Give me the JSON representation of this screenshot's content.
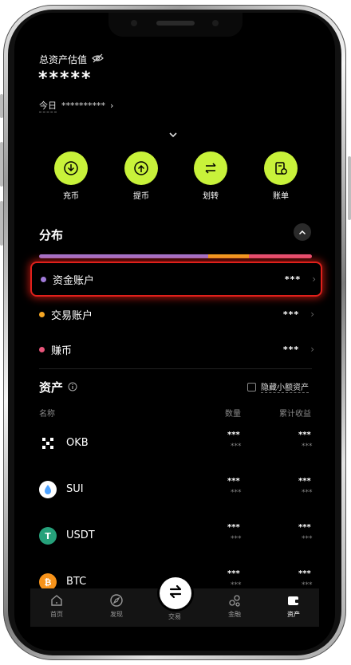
{
  "header": {
    "total_label": "总资产估值",
    "total_value": "*****",
    "today_label": "今日",
    "today_value": "**********"
  },
  "actions": [
    {
      "label": "充币",
      "icon": "deposit-icon"
    },
    {
      "label": "提币",
      "icon": "withdraw-icon"
    },
    {
      "label": "划转",
      "icon": "transfer-icon"
    },
    {
      "label": "账单",
      "icon": "bill-icon"
    }
  ],
  "distribution": {
    "title": "分布",
    "bar_shares": [
      0.62,
      0.15,
      0.23
    ],
    "bar_colors": [
      "#a07ad8",
      "#f5a623",
      "#e8557a"
    ],
    "rows": [
      {
        "name": "资金账户",
        "value": "***",
        "dot": "#a07ad8"
      },
      {
        "name": "交易账户",
        "value": "***",
        "dot": "#f5a623"
      },
      {
        "name": "赚币",
        "value": "***",
        "dot": "#e8557a"
      }
    ]
  },
  "assets": {
    "title": "资产",
    "hide_small_label": "隐藏小额资产",
    "col_name": "名称",
    "col_qty": "数量",
    "col_pnl": "累计收益",
    "items": [
      {
        "symbol": "OKB",
        "qty": "***",
        "qty_sub": "***",
        "pnl": "***",
        "pnl_sub": "***"
      },
      {
        "symbol": "SUI",
        "qty": "***",
        "qty_sub": "***",
        "pnl": "***",
        "pnl_sub": "***"
      },
      {
        "symbol": "USDT",
        "qty": "***",
        "qty_sub": "***",
        "pnl": "***",
        "pnl_sub": "***"
      },
      {
        "symbol": "BTC",
        "qty": "***",
        "qty_sub": "***",
        "pnl": "***",
        "pnl_sub": "***"
      }
    ]
  },
  "tabbar": {
    "items": [
      {
        "label": "首页",
        "icon": "home-icon"
      },
      {
        "label": "发现",
        "icon": "discover-icon"
      },
      {
        "label": "交易",
        "icon": "trade-icon"
      },
      {
        "label": "金融",
        "icon": "finance-icon"
      },
      {
        "label": "资产",
        "icon": "wallet-icon"
      }
    ]
  },
  "colors": {
    "accent": "#c8f23a",
    "highlight": "#e0201b",
    "background": "#000000"
  }
}
